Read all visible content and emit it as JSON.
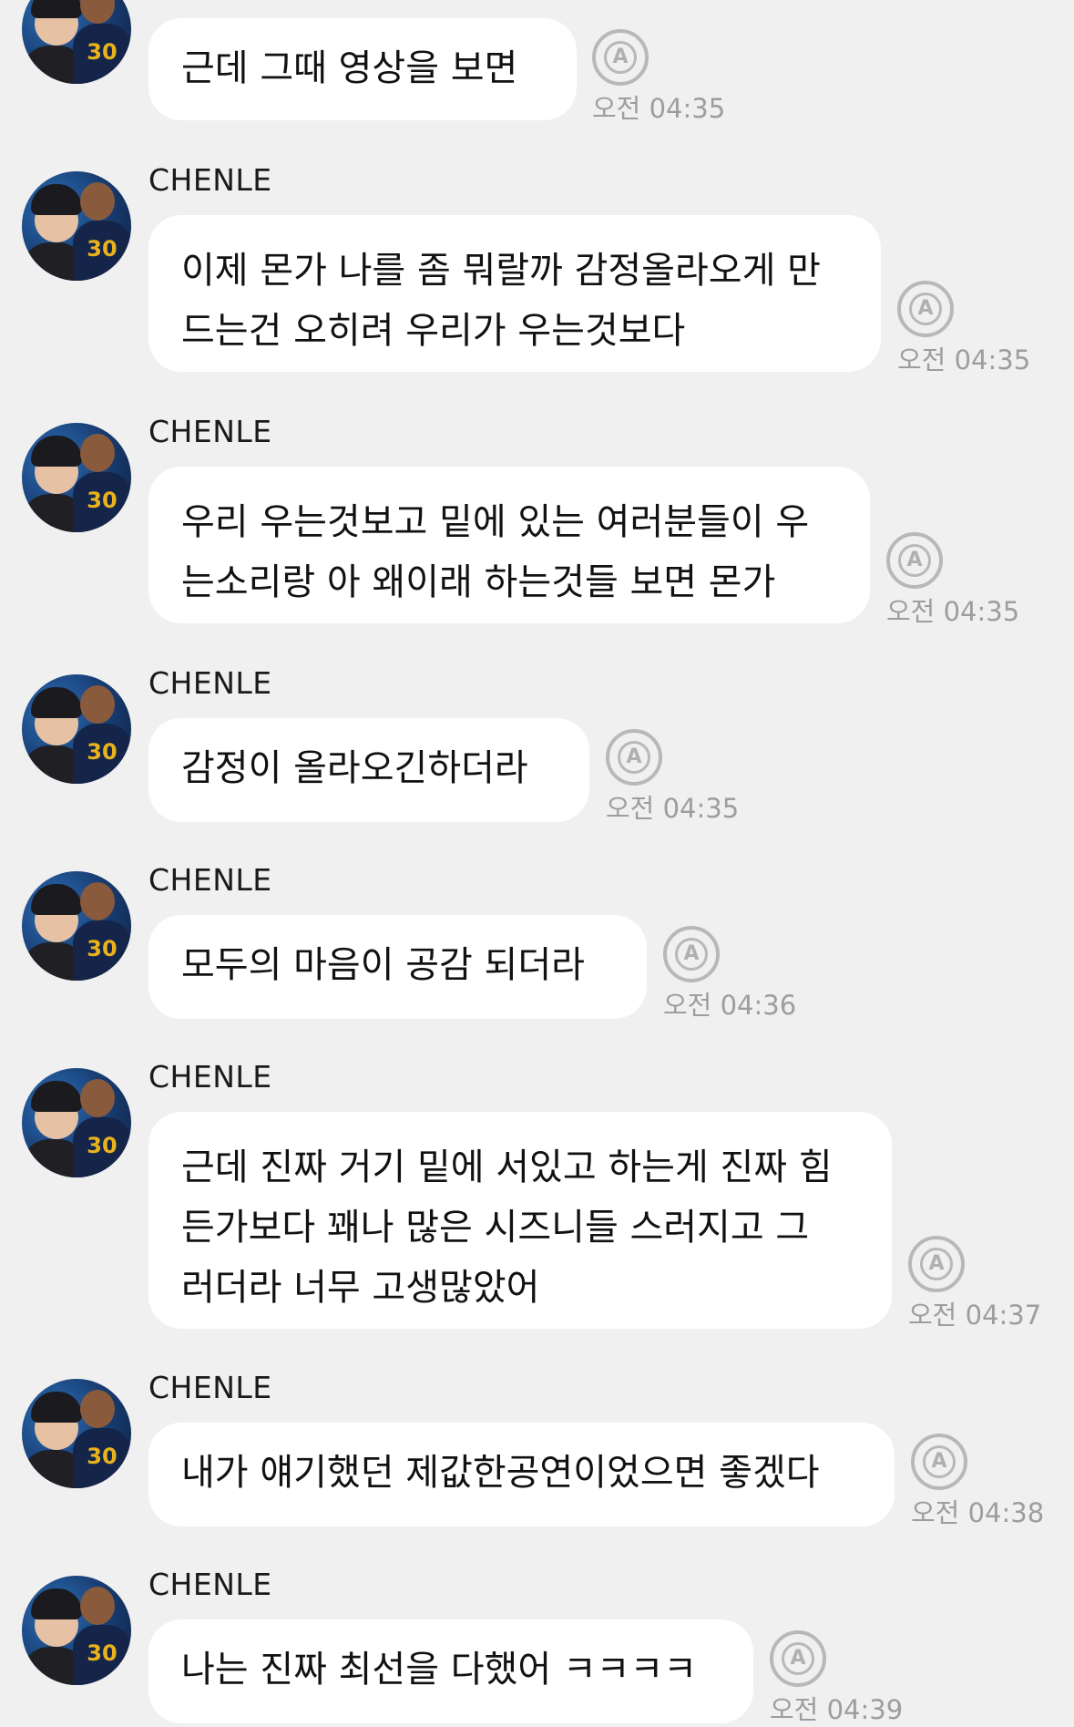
{
  "messages": [
    {
      "sender": "",
      "lines": [
        "근데 그때 영상을 보면"
      ],
      "read_icon": "auto-translate-icon",
      "time": "오전 04:35"
    },
    {
      "sender": "CHENLE",
      "lines": [
        "이제 몬가 나를 좀 뭐랄까 감정올라오게 만",
        "드는건 오히려 우리가 우는것보다"
      ],
      "read_icon": "auto-translate-icon",
      "time": "오전 04:35"
    },
    {
      "sender": "CHENLE",
      "lines": [
        "우리 우는것보고 밑에 있는 여러분들이 우",
        "는소리랑 아 왜이래 하는것들 보면 몬가"
      ],
      "read_icon": "auto-translate-icon",
      "time": "오전 04:35"
    },
    {
      "sender": "CHENLE",
      "lines": [
        "감정이 올라오긴하더라"
      ],
      "read_icon": "auto-translate-icon",
      "time": "오전 04:35"
    },
    {
      "sender": "CHENLE",
      "lines": [
        "모두의 마음이 공감 되더라"
      ],
      "read_icon": "auto-translate-icon",
      "time": "오전 04:36"
    },
    {
      "sender": "CHENLE",
      "lines": [
        "근데 진짜 거기 밑에 서있고 하는게 진짜 힘",
        "든가보다 꽤나 많은 시즈니들 스러지고 그",
        "러더라 너무 고생많았어"
      ],
      "read_icon": "auto-translate-icon",
      "time": "오전 04:37"
    },
    {
      "sender": "CHENLE",
      "lines": [
        "내가 얘기했던 제값한공연이었으면 좋겠다"
      ],
      "read_icon": "auto-translate-icon",
      "time": "오전 04:38"
    },
    {
      "sender": "CHENLE",
      "lines": [
        "나는 진짜 최선을 다했어 ㅋㅋㅋㅋ"
      ],
      "read_icon": "auto-translate-icon",
      "time": "오전 04:39"
    }
  ],
  "colors": {
    "background": "#f0f0f1",
    "bubble": "#ffffff",
    "meta": "#9d9da0"
  }
}
